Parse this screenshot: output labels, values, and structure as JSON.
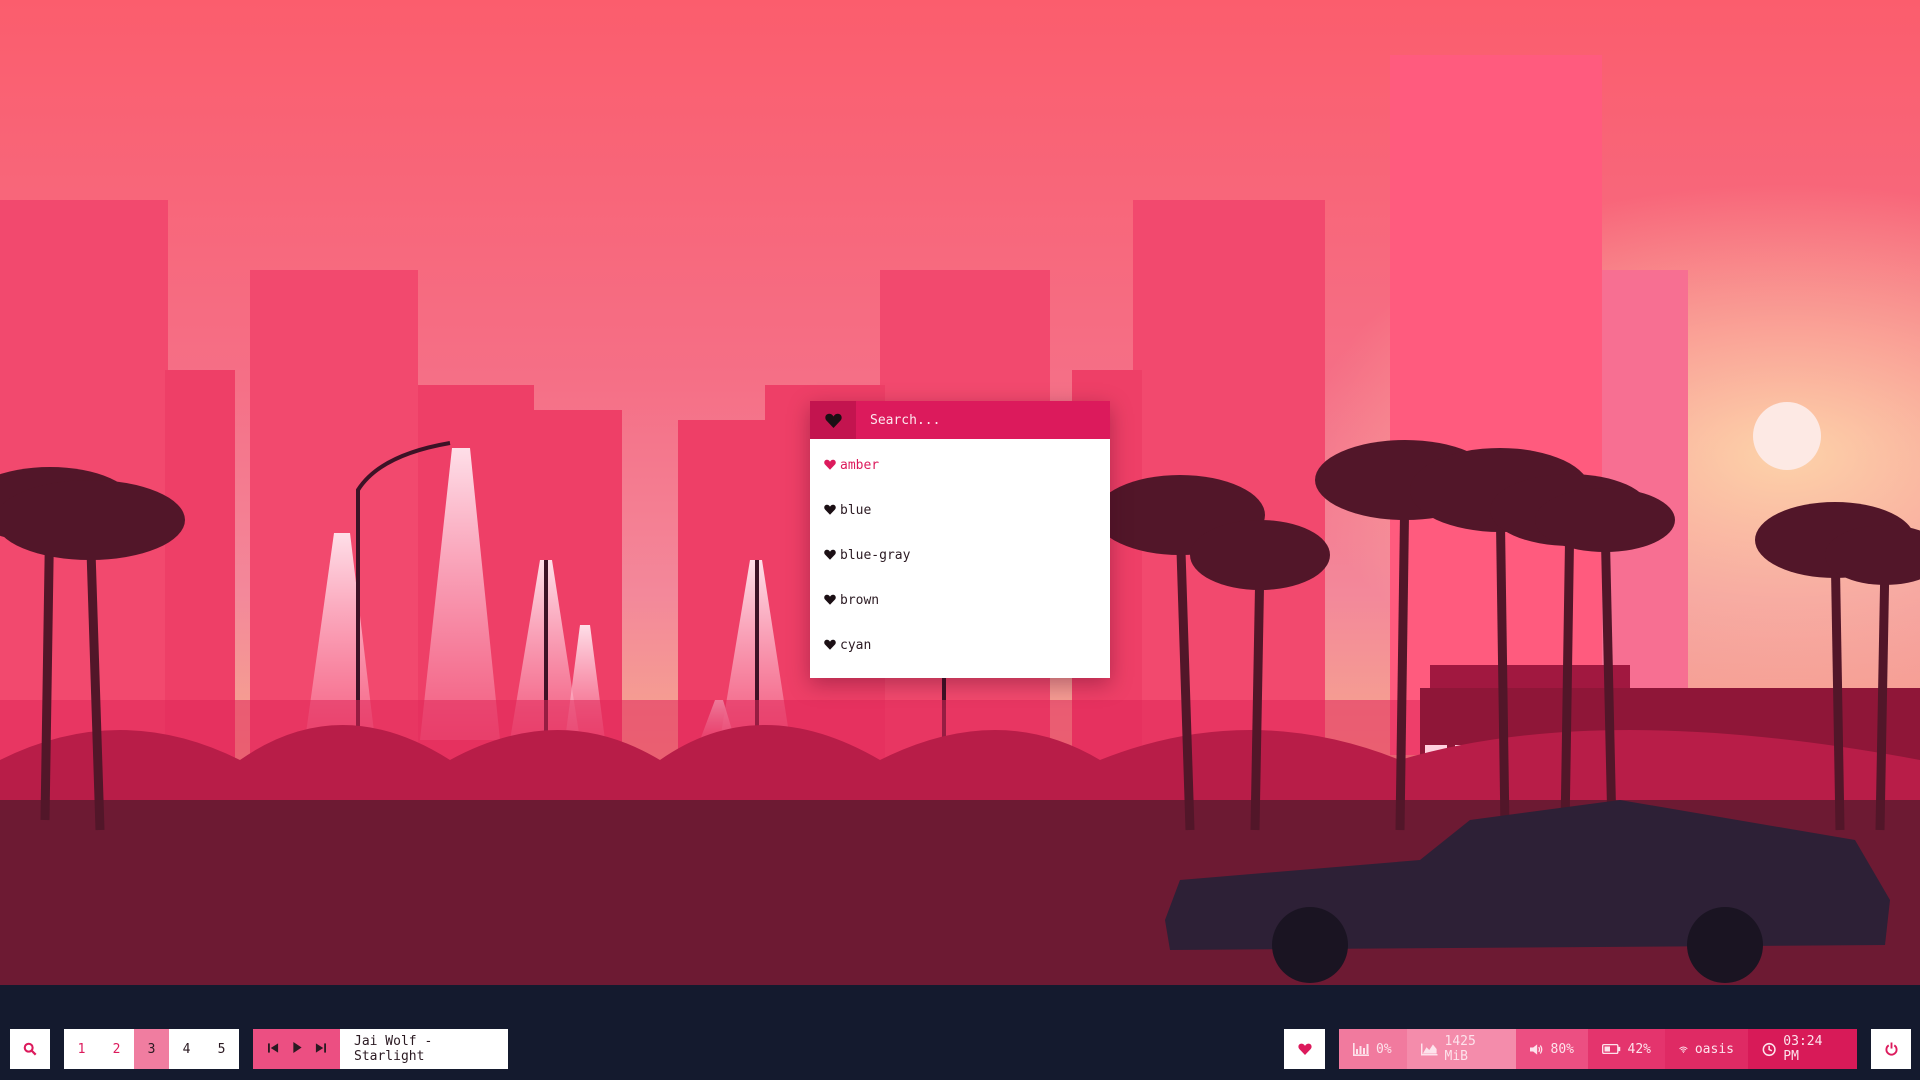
{
  "launcher": {
    "placeholder": "Search...",
    "items": [
      {
        "label": "amber",
        "selected": true
      },
      {
        "label": "blue",
        "selected": false
      },
      {
        "label": "blue-gray",
        "selected": false
      },
      {
        "label": "brown",
        "selected": false
      },
      {
        "label": "cyan",
        "selected": false
      }
    ]
  },
  "bar": {
    "workspaces": [
      "1",
      "2",
      "3",
      "4",
      "5"
    ],
    "active_workspace": "3",
    "now_playing": "Jai Wolf - Starlight",
    "cpu": "0%",
    "memory": "1425 MiB",
    "volume": "80%",
    "battery": "42%",
    "wifi": "oasis",
    "clock": "03:24 PM"
  },
  "colors": {
    "accent": "#dc1a5c",
    "bar_pink": "#ec4f82",
    "sky_top": "#fb5f6e",
    "ground": "#141a2e"
  },
  "icons": [
    "search-icon",
    "heart-icon",
    "prev-icon",
    "play-icon",
    "next-icon",
    "cpu-icon",
    "memory-icon",
    "volume-icon",
    "battery-icon",
    "wifi-icon",
    "clock-icon",
    "power-icon"
  ]
}
